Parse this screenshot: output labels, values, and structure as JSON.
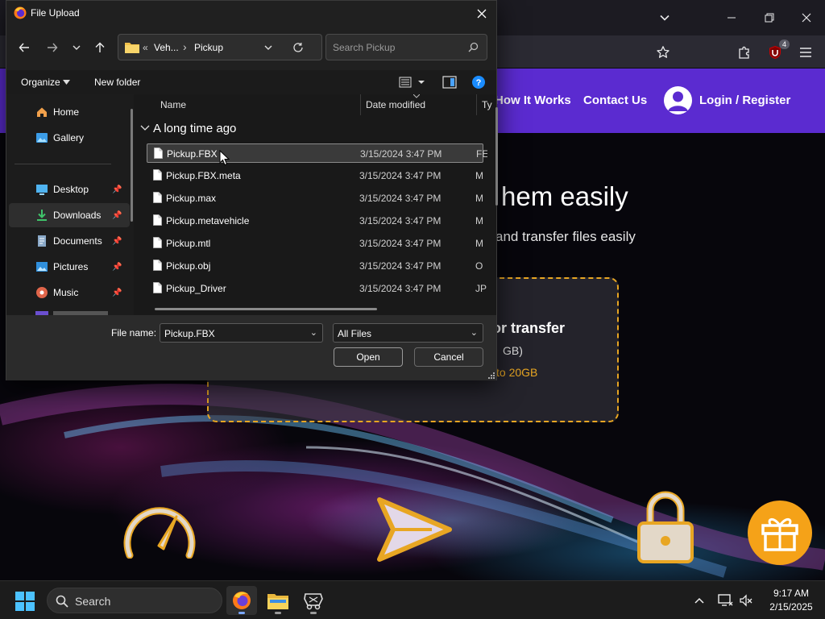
{
  "browser": {
    "tab_list_icon": "chevron-down-icon",
    "extension_badge": "4"
  },
  "page": {
    "nav": {
      "how_it_works": "How It Works",
      "contact_us": "Contact Us",
      "login_register": "Login / Register"
    },
    "hero_title_fragment": "hem easily",
    "hero_sub_fragment": "and transfer files easily",
    "dropzone": {
      "line1_fragment": "or transfer",
      "line2_fragment": "GB)",
      "line3_fragment": "to 20GB"
    },
    "accent_color": "#e8a623",
    "nav_color": "#5b2bd0",
    "feature_icons": [
      "speedometer-icon",
      "send-icon",
      "lock-icon",
      "gift-icon"
    ]
  },
  "dialog": {
    "title": "File Upload",
    "breadcrumb": {
      "prefix": "«",
      "parent": "Veh...",
      "separator": "›",
      "current": "Pickup"
    },
    "search_placeholder": "Search Pickup",
    "commands": {
      "organize": "Organize",
      "new_folder": "New folder"
    },
    "sidebar": [
      {
        "label": "Home",
        "icon": "home-icon",
        "pinned": false
      },
      {
        "label": "Gallery",
        "icon": "gallery-icon",
        "pinned": false
      },
      {
        "label": "Desktop",
        "icon": "desktop-icon",
        "pinned": true
      },
      {
        "label": "Downloads",
        "icon": "download-icon",
        "pinned": true,
        "selected": true
      },
      {
        "label": "Documents",
        "icon": "documents-icon",
        "pinned": true
      },
      {
        "label": "Pictures",
        "icon": "pictures-icon",
        "pinned": true
      },
      {
        "label": "Music",
        "icon": "music-icon",
        "pinned": true
      }
    ],
    "columns": {
      "name": "Name",
      "date": "Date modified",
      "type": "Ty"
    },
    "group_label": "A long time ago",
    "files": [
      {
        "name": "Pickup.FBX",
        "date": "3/15/2024 3:47 PM",
        "type": "FE",
        "selected": true
      },
      {
        "name": "Pickup.FBX.meta",
        "date": "3/15/2024 3:47 PM",
        "type": "M"
      },
      {
        "name": "Pickup.max",
        "date": "3/15/2024 3:47 PM",
        "type": "M"
      },
      {
        "name": "Pickup.metavehicle",
        "date": "3/15/2024 3:47 PM",
        "type": "M"
      },
      {
        "name": "Pickup.mtl",
        "date": "3/15/2024 3:47 PM",
        "type": "M"
      },
      {
        "name": "Pickup.obj",
        "date": "3/15/2024 3:47 PM",
        "type": "O"
      },
      {
        "name": "Pickup_Driver",
        "date": "3/15/2024 3:47 PM",
        "type": "JP"
      }
    ],
    "file_name_label": "File name:",
    "file_name_value": "Pickup.FBX",
    "file_type_value": "All Files",
    "open_label": "Open",
    "cancel_label": "Cancel"
  },
  "taskbar": {
    "search_label": "Search",
    "time": "9:17 AM",
    "date": "2/15/2025"
  }
}
